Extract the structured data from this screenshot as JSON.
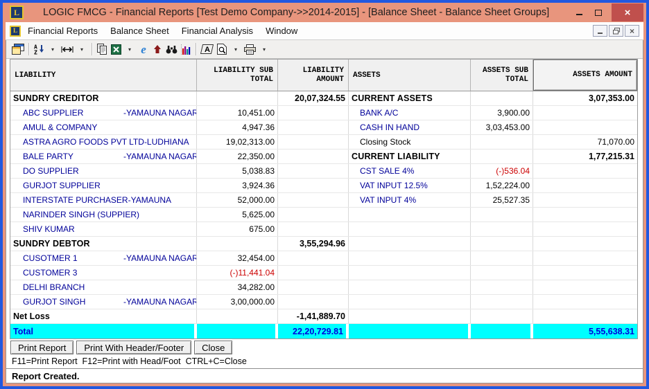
{
  "window": {
    "title": "LOGIC FMCG - Financial Reports  [Test Demo Company->>2014-2015] - [Balance Sheet - Balance Sheet Groups]",
    "app_icon_letter": "L",
    "controls": {
      "close_glyph": "×"
    }
  },
  "menu": {
    "items": [
      {
        "label": "Financial Reports"
      },
      {
        "label": "Balance Sheet"
      },
      {
        "label": "Financial Analysis"
      },
      {
        "label": "Window"
      }
    ]
  },
  "mdi_controls": {
    "close_glyph": "×"
  },
  "toolbar": {
    "icons": [
      "report-window",
      "sort-az",
      "column-width",
      "copy",
      "export-excel",
      "internet-explorer",
      "move-up",
      "find",
      "chart",
      "font",
      "print-preview",
      "print"
    ]
  },
  "colors": {
    "desktop_border": "#2158e0",
    "titlebar": "#e8957d",
    "close_red": "#c0504d",
    "detail_text": "#000099",
    "negative": "#cc0000",
    "total_bg": "#00ffff",
    "total_text": "#0000dd"
  },
  "table": {
    "headers": [
      "LIABILITY",
      "LIABILITY SUB TOTAL",
      "LIABILITY AMOUNT",
      "ASSETS",
      "ASSETS SUB TOTAL",
      "ASSETS AMOUNT"
    ],
    "rows": [
      {
        "l": {
          "name": "SUNDRY CREDITOR",
          "style": "group",
          "amt": "20,07,324.55"
        },
        "r": {
          "name": "CURRENT ASSETS",
          "style": "group",
          "amt": "3,07,353.00"
        }
      },
      {
        "l": {
          "name": "ABC SUPPLIER",
          "loc": "-YAMAUNA NAGAR",
          "style": "detail",
          "sub": "10,451.00"
        },
        "r": {
          "name": "BANK A/C",
          "style": "detail",
          "sub": "3,900.00"
        }
      },
      {
        "l": {
          "name": "AMUL & COMPANY",
          "style": "detail",
          "sub": "4,947.36"
        },
        "r": {
          "name": "CASH IN HAND",
          "style": "detail",
          "sub": "3,03,453.00"
        }
      },
      {
        "l": {
          "name": "ASTRA AGRO FOODS PVT LTD",
          "loc": "-LUDHIANA",
          "style": "detail",
          "sub": "19,02,313.00"
        },
        "r": {
          "name": "Closing Stock",
          "style": "plain",
          "amt": "71,070.00"
        }
      },
      {
        "l": {
          "name": "BALE PARTY",
          "loc": "-YAMAUNA NAGAR",
          "style": "detail",
          "sub": "22,350.00"
        },
        "r": {
          "name": "CURRENT LIABILITY",
          "style": "group",
          "amt": "1,77,215.31"
        }
      },
      {
        "l": {
          "name": "DO SUPPLIER",
          "style": "detail",
          "sub": "5,038.83"
        },
        "r": {
          "name": "CST SALE 4%",
          "style": "detail",
          "sub": "(-)536.04",
          "neg": true
        }
      },
      {
        "l": {
          "name": "GURJOT SUPPLIER",
          "style": "detail",
          "sub": "3,924.36"
        },
        "r": {
          "name": "VAT INPUT 12.5%",
          "style": "detail",
          "sub": "1,52,224.00"
        }
      },
      {
        "l": {
          "name": "INTERSTATE PURCHASER",
          "loc": "-YAMAUNA",
          "style": "detail",
          "sub": "52,000.00"
        },
        "r": {
          "name": "VAT INPUT 4%",
          "style": "detail",
          "sub": "25,527.35"
        }
      },
      {
        "l": {
          "name": "NARINDER SINGH (SUPPIER)",
          "style": "detail",
          "sub": "5,625.00"
        },
        "r": {}
      },
      {
        "l": {
          "name": "SHIV KUMAR",
          "style": "detail",
          "sub": "675.00"
        },
        "r": {}
      },
      {
        "l": {
          "name": "SUNDRY DEBTOR",
          "style": "group",
          "amt": "3,55,294.96"
        },
        "r": {}
      },
      {
        "l": {
          "name": "CUSOTMER 1",
          "loc": "-YAMAUNA NAGAR",
          "style": "detail",
          "sub": "32,454.00"
        },
        "r": {}
      },
      {
        "l": {
          "name": "CUSTOMER 3",
          "style": "detail",
          "sub": "(-)11,441.04",
          "neg": true
        },
        "r": {}
      },
      {
        "l": {
          "name": "DELHI BRANCH",
          "style": "detail",
          "sub": "34,282.00"
        },
        "r": {}
      },
      {
        "l": {
          "name": "GURJOT SINGH",
          "loc": "-YAMAUNA NAGAR",
          "style": "detail",
          "sub": "3,00,000.00"
        },
        "r": {}
      },
      {
        "l": {
          "name": "Net Loss",
          "style": "net",
          "amt": "-1,41,889.70"
        },
        "r": {}
      }
    ],
    "total": {
      "label": "Total",
      "liability_amount": "22,20,729.81",
      "assets_amount": "5,55,638.31"
    }
  },
  "buttons": [
    {
      "label": "Print Report"
    },
    {
      "label": "Print With Header/Footer"
    },
    {
      "label": "Close"
    }
  ],
  "hint": "F11=Print Report  F12=Print with Head/Foot  CTRL+C=Close",
  "status": "Report Created."
}
